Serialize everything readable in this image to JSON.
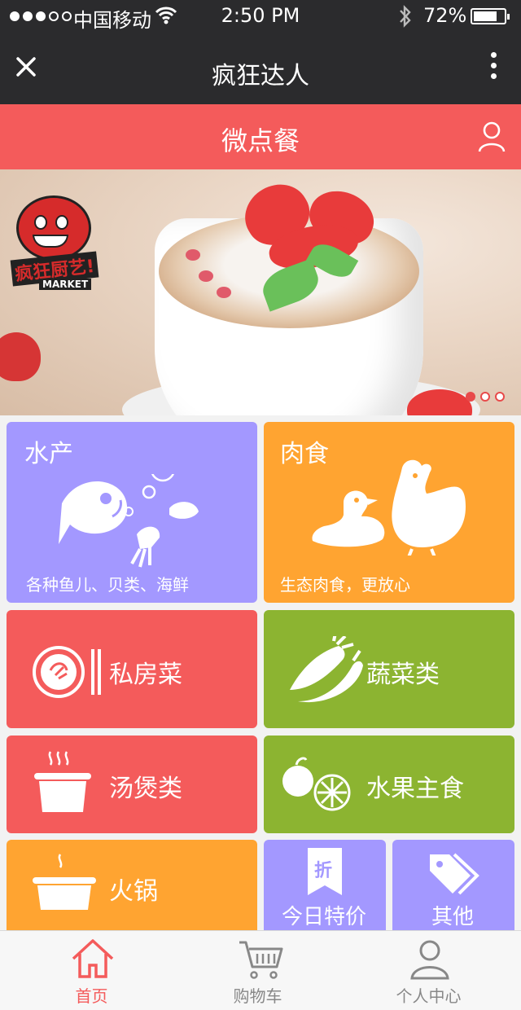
{
  "status_bar": {
    "carrier": "中国移动",
    "time": "2:50 PM",
    "battery": "72%",
    "signal_bars": 3,
    "signal_total": 5
  },
  "navbar": {
    "title": "疯狂达人"
  },
  "header": {
    "title": "微点餐"
  },
  "banner": {
    "logo_text": "疯狂厨艺!",
    "logo_market": "MARKET",
    "page_count": 3,
    "active_page": 1
  },
  "categories": {
    "seafood": {
      "name": "水产",
      "subtitle": "各种鱼儿、贝类、海鲜"
    },
    "meat": {
      "name": "肉食",
      "subtitle": "生态肉食，更放心"
    },
    "private": {
      "name": "私房菜"
    },
    "vegetables": {
      "name": "蔬菜类"
    },
    "soup": {
      "name": "汤煲类"
    },
    "fruit": {
      "name": "水果主食"
    },
    "hotpot": {
      "name": "火锅"
    },
    "special": {
      "name": "今日特价",
      "badge": "折"
    },
    "other": {
      "name": "其他"
    }
  },
  "tabbar": {
    "items": [
      {
        "label": "首页"
      },
      {
        "label": "购物车"
      },
      {
        "label": "个人中心"
      }
    ]
  },
  "colors": {
    "nav": "#2b2b2d",
    "accent": "#f45b5b",
    "purple": "#a398ff",
    "orange": "#ffa431",
    "green": "#8cb431"
  }
}
